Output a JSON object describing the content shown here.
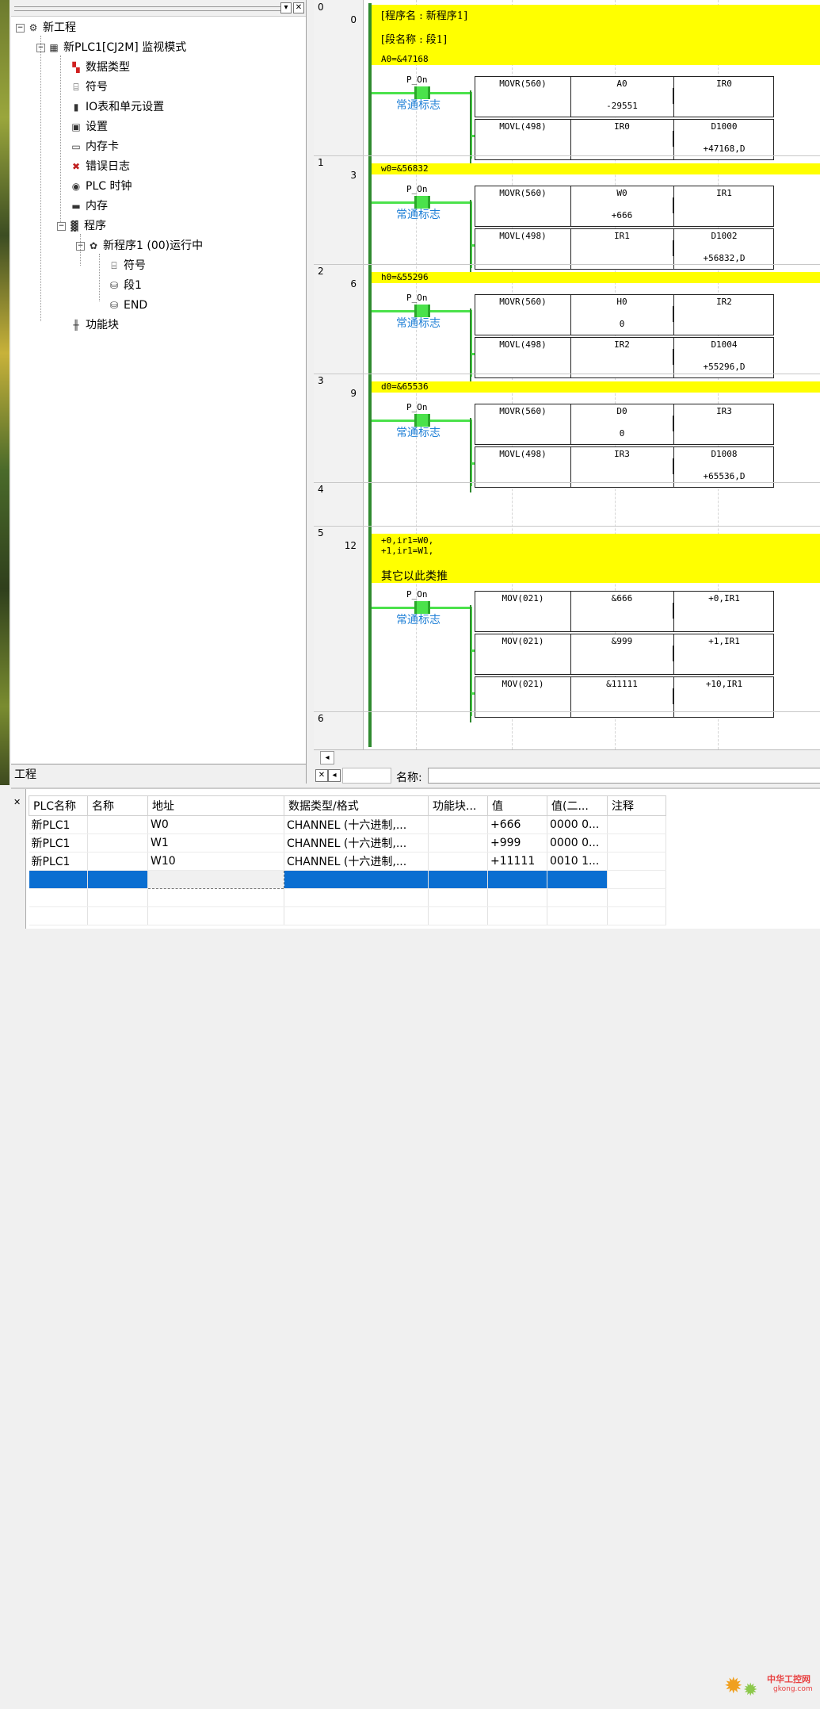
{
  "tree": {
    "tab_label": "工程",
    "items": [
      {
        "label": "新工程",
        "icon": "network-icon"
      },
      {
        "label": "新PLC1[CJ2M] 监视模式",
        "icon": "plc-icon"
      },
      {
        "label": "数据类型",
        "icon": "datatype-icon"
      },
      {
        "label": "符号",
        "icon": "symbol-icon"
      },
      {
        "label": "IO表和单元设置",
        "icon": "io-table-icon"
      },
      {
        "label": "设置",
        "icon": "settings-icon"
      },
      {
        "label": "内存卡",
        "icon": "memory-card-icon"
      },
      {
        "label": "错误日志",
        "icon": "error-log-icon"
      },
      {
        "label": "PLC 时钟",
        "icon": "clock-icon"
      },
      {
        "label": "内存",
        "icon": "memory-icon"
      },
      {
        "label": "程序",
        "icon": "programs-icon"
      },
      {
        "label": "新程序1 (00)运行中",
        "icon": "program-running-icon"
      },
      {
        "label": "符号",
        "icon": "symbol-icon"
      },
      {
        "label": "段1",
        "icon": "section-icon"
      },
      {
        "label": "END",
        "icon": "section-icon"
      },
      {
        "label": "功能块",
        "icon": "function-block-icon"
      }
    ]
  },
  "ladder": {
    "header": {
      "program_name": "[程序名 : 新程序1]",
      "section_name": "[段名称 : 段1]"
    },
    "rungs": [
      {
        "num": "0",
        "step": "0",
        "comment": "A0=&47168",
        "contact": {
          "name": "P_On",
          "comment": "常通标志"
        },
        "blocks": [
          {
            "instr": "MOVR(560)",
            "op1": "A0",
            "op1_val": "-29551",
            "op2": "IR0",
            "op2_val": ""
          },
          {
            "instr": "MOVL(498)",
            "op1": "IR0",
            "op1_val": "",
            "op2": "D1000",
            "op2_val": "+47168,D"
          }
        ]
      },
      {
        "num": "1",
        "step": "3",
        "comment": "w0=&56832",
        "contact": {
          "name": "P_On",
          "comment": "常通标志"
        },
        "blocks": [
          {
            "instr": "MOVR(560)",
            "op1": "W0",
            "op1_val": "+666",
            "op2": "IR1",
            "op2_val": ""
          },
          {
            "instr": "MOVL(498)",
            "op1": "IR1",
            "op1_val": "",
            "op2": "D1002",
            "op2_val": "+56832,D"
          }
        ]
      },
      {
        "num": "2",
        "step": "6",
        "comment": "h0=&55296",
        "contact": {
          "name": "P_On",
          "comment": "常通标志"
        },
        "blocks": [
          {
            "instr": "MOVR(560)",
            "op1": "H0",
            "op1_val": "0",
            "op2": "IR2",
            "op2_val": ""
          },
          {
            "instr": "MOVL(498)",
            "op1": "IR2",
            "op1_val": "",
            "op2": "D1004",
            "op2_val": "+55296,D"
          }
        ]
      },
      {
        "num": "3",
        "step": "9",
        "comment": "d0=&65536",
        "contact": {
          "name": "P_On",
          "comment": "常通标志"
        },
        "blocks": [
          {
            "instr": "MOVR(560)",
            "op1": "D0",
            "op1_val": "0",
            "op2": "IR3",
            "op2_val": ""
          },
          {
            "instr": "MOVL(498)",
            "op1": "IR3",
            "op1_val": "",
            "op2": "D1008",
            "op2_val": "+65536,D"
          }
        ]
      },
      {
        "num": "4",
        "step": ""
      },
      {
        "num": "5",
        "step": "12",
        "comment_lines": [
          "+0,ir1=W0,",
          "+1,ir1=W1,",
          "",
          "其它以此类推"
        ],
        "contact": {
          "name": "P_On",
          "comment": "常通标志"
        },
        "blocks": [
          {
            "instr": "MOV(021)",
            "op1": "&666",
            "op1_val": "",
            "op2": "+0,IR1",
            "op2_val": ""
          },
          {
            "instr": "MOV(021)",
            "op1": "&999",
            "op1_val": "",
            "op2": "+1,IR1",
            "op2_val": ""
          },
          {
            "instr": "MOV(021)",
            "op1": "&11111",
            "op1_val": "",
            "op2": "+10,IR1",
            "op2_val": ""
          }
        ]
      },
      {
        "num": "6",
        "step": ""
      }
    ],
    "name_label": "名称:",
    "name_value": ""
  },
  "watch": {
    "columns": [
      "PLC名称",
      "名称",
      "地址",
      "数据类型/格式",
      "功能块...",
      "值",
      "值(二...",
      "注释"
    ],
    "rows": [
      [
        "新PLC1",
        "",
        "W0",
        "CHANNEL (十六进制,...",
        "",
        "+666",
        "0000 0...",
        ""
      ],
      [
        "新PLC1",
        "",
        "W1",
        "CHANNEL (十六进制,...",
        "",
        "+999",
        "0000 0...",
        ""
      ],
      [
        "新PLC1",
        "",
        "W10",
        "CHANNEL (十六进制,...",
        "",
        "+11111",
        "0010 1...",
        ""
      ]
    ],
    "watermark_title": "中华工控网",
    "watermark_url": "gkong.com"
  },
  "colors": {
    "comment_bg": "#ffff00",
    "power_flow": "#4be24b",
    "rail": "#2f8a2f",
    "selection": "#0a6ed1",
    "contact_comment": "#1e7fd6"
  }
}
